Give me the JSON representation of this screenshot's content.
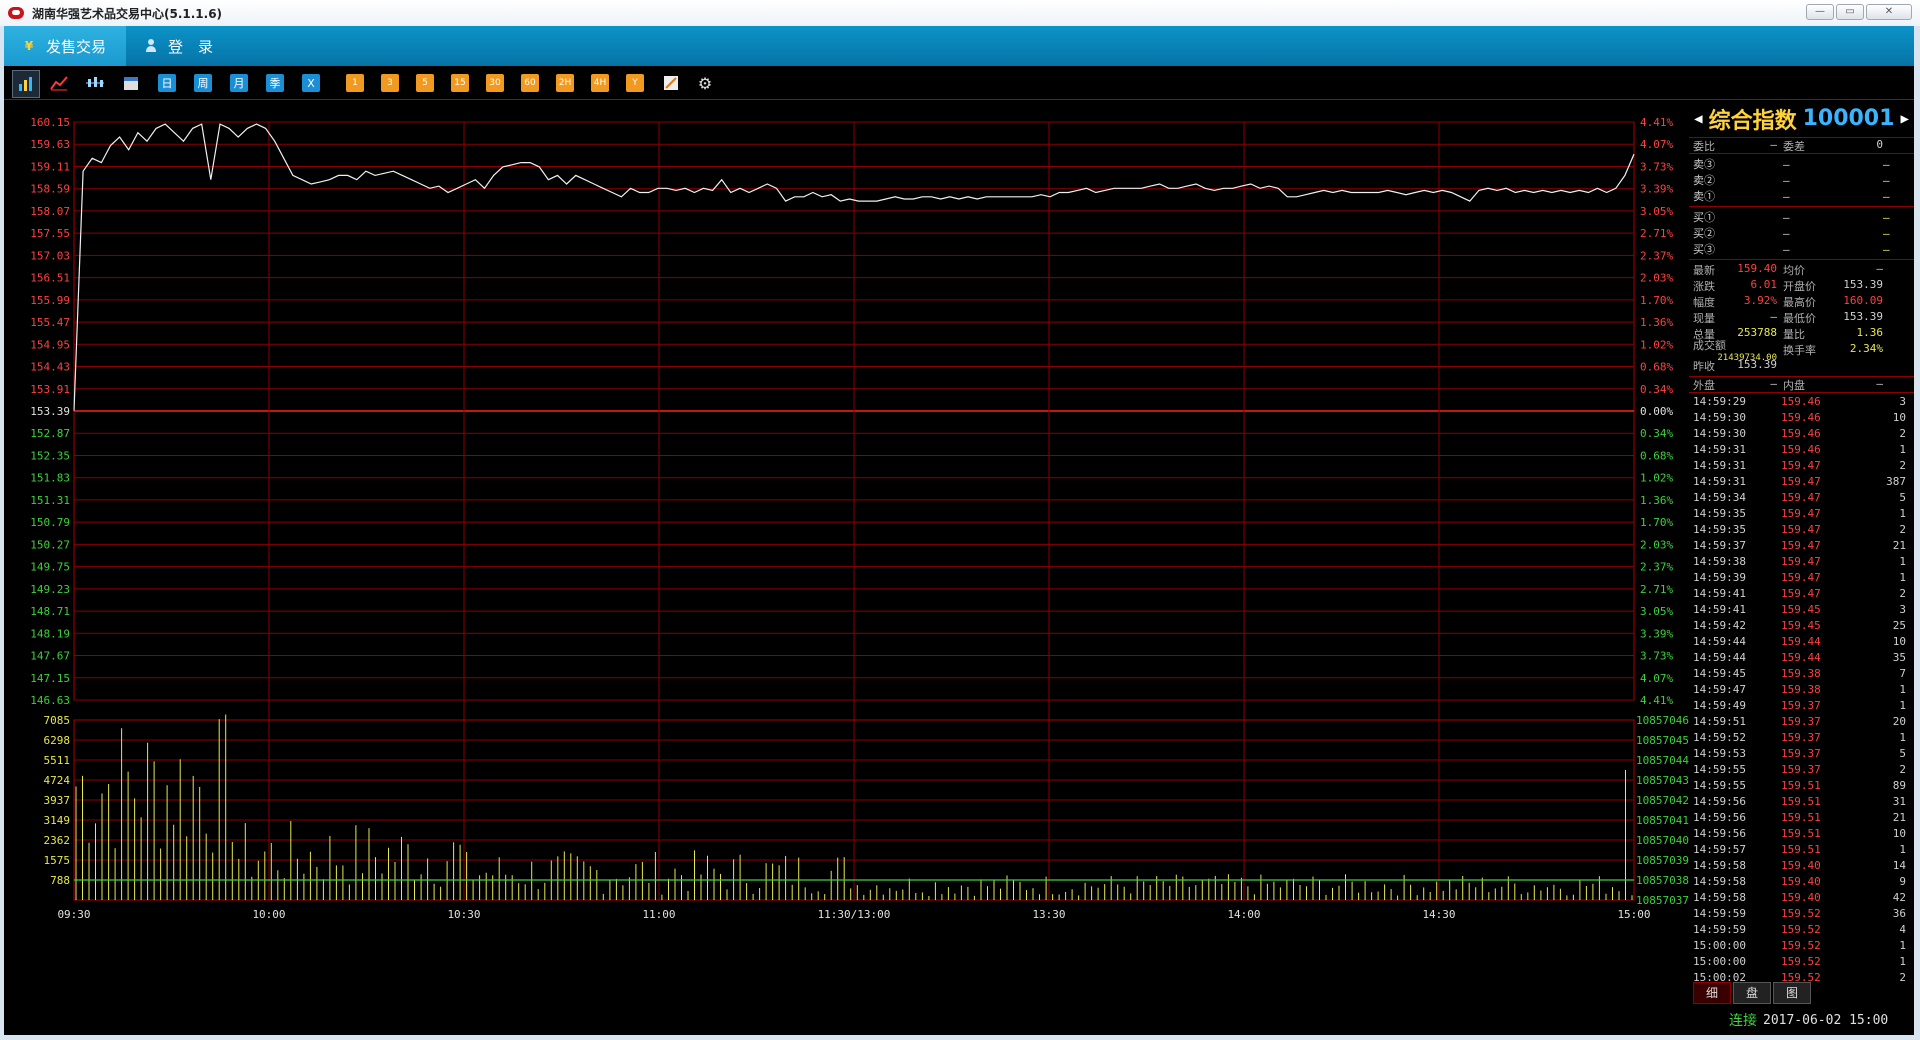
{
  "window": {
    "title": "湖南华强艺术品交易中心(5.1.1.6)"
  },
  "menu": {
    "items": [
      {
        "label": "发售交易"
      },
      {
        "label": "登　录"
      }
    ]
  },
  "toolbar": {
    "periods": [
      "日",
      "周",
      "月",
      "季",
      "X"
    ],
    "minutes": [
      "1",
      "3",
      "5",
      "15",
      "30",
      "60",
      "2H",
      "4H",
      "Y"
    ]
  },
  "quote": {
    "name": "综合指数",
    "code": "100001",
    "weibi_label": "委比",
    "weibi": "—",
    "weicha_label": "委差",
    "weicha": "0",
    "sells": [
      {
        "label": "卖③",
        "price": "—",
        "vol": "—"
      },
      {
        "label": "卖②",
        "price": "—",
        "vol": "—"
      },
      {
        "label": "卖①",
        "price": "—",
        "vol": "—"
      }
    ],
    "buys": [
      {
        "label": "买①",
        "price": "—",
        "vol": "—"
      },
      {
        "label": "买②",
        "price": "—",
        "vol": "—"
      },
      {
        "label": "买③",
        "price": "—",
        "vol": "—"
      }
    ],
    "stats": [
      {
        "l1": "最新",
        "v1": "159.40",
        "l2": "均价",
        "v2": "—"
      },
      {
        "l1": "涨跌",
        "v1": "6.01",
        "l2": "开盘价",
        "v2": "153.39"
      },
      {
        "l1": "幅度",
        "v1": "3.92%",
        "l2": "最高价",
        "v2": "160.09"
      },
      {
        "l1": "现量",
        "v1": "—",
        "l2": "最低价",
        "v2": "153.39"
      },
      {
        "l1": "总量",
        "v1": "253788",
        "l2": "量比",
        "v2": "1.36"
      },
      {
        "l1": "成交额",
        "v1": "21439734.00",
        "l2": "换手率",
        "v2": "2.34%"
      },
      {
        "l1": "昨收",
        "v1": "153.39",
        "l2": "",
        "v2": ""
      }
    ],
    "waipan_label": "外盘",
    "waipan": "—",
    "neipan_label": "内盘",
    "neipan": "—"
  },
  "ticks": [
    [
      "14:59:29",
      "159.46",
      "3"
    ],
    [
      "14:59:30",
      "159.46",
      "10"
    ],
    [
      "14:59:30",
      "159.46",
      "2"
    ],
    [
      "14:59:31",
      "159.46",
      "1"
    ],
    [
      "14:59:31",
      "159.47",
      "2"
    ],
    [
      "14:59:31",
      "159.47",
      "387"
    ],
    [
      "14:59:34",
      "159.47",
      "5"
    ],
    [
      "14:59:35",
      "159.47",
      "1"
    ],
    [
      "14:59:35",
      "159.47",
      "2"
    ],
    [
      "14:59:37",
      "159.47",
      "21"
    ],
    [
      "14:59:38",
      "159.47",
      "1"
    ],
    [
      "14:59:39",
      "159.47",
      "1"
    ],
    [
      "14:59:41",
      "159.47",
      "2"
    ],
    [
      "14:59:41",
      "159.45",
      "3"
    ],
    [
      "14:59:42",
      "159.45",
      "25"
    ],
    [
      "14:59:44",
      "159.44",
      "10"
    ],
    [
      "14:59:44",
      "159.44",
      "35"
    ],
    [
      "14:59:45",
      "159.38",
      "7"
    ],
    [
      "14:59:47",
      "159.38",
      "1"
    ],
    [
      "14:59:49",
      "159.37",
      "1"
    ],
    [
      "14:59:51",
      "159.37",
      "20"
    ],
    [
      "14:59:52",
      "159.37",
      "1"
    ],
    [
      "14:59:53",
      "159.37",
      "5"
    ],
    [
      "14:59:55",
      "159.37",
      "2"
    ],
    [
      "14:59:55",
      "159.51",
      "89"
    ],
    [
      "14:59:56",
      "159.51",
      "31"
    ],
    [
      "14:59:56",
      "159.51",
      "21"
    ],
    [
      "14:59:56",
      "159.51",
      "10"
    ],
    [
      "14:59:57",
      "159.51",
      "1"
    ],
    [
      "14:59:58",
      "159.40",
      "14"
    ],
    [
      "14:59:58",
      "159.40",
      "9"
    ],
    [
      "14:59:58",
      "159.40",
      "42"
    ],
    [
      "14:59:59",
      "159.52",
      "36"
    ],
    [
      "14:59:59",
      "159.52",
      "4"
    ],
    [
      "15:00:00",
      "159.52",
      "1"
    ],
    [
      "15:00:00",
      "159.52",
      "1"
    ],
    [
      "15:00:02",
      "159.52",
      "2"
    ]
  ],
  "tabs": [
    "细",
    "盘",
    "图"
  ],
  "status": {
    "conn": "连接",
    "datetime": "2017-06-02 15:00"
  },
  "chart_data": {
    "type": "line",
    "price_ticks_up": [
      "160.15",
      "159.63",
      "159.11",
      "158.59",
      "158.07",
      "157.55",
      "157.03",
      "156.51",
      "155.99",
      "155.47",
      "154.95",
      "154.43",
      "153.91"
    ],
    "price_mid": "153.39",
    "price_ticks_down": [
      "152.87",
      "152.35",
      "151.83",
      "151.31",
      "150.79",
      "150.27",
      "149.75",
      "149.23",
      "148.71",
      "148.19",
      "147.67",
      "147.15",
      "146.63"
    ],
    "pct_ticks_up": [
      "4.41%",
      "4.07%",
      "3.73%",
      "3.39%",
      "3.05%",
      "2.71%",
      "2.37%",
      "2.03%",
      "1.70%",
      "1.36%",
      "1.02%",
      "0.68%",
      "0.34%"
    ],
    "pct_mid": "0.00%",
    "pct_ticks_down": [
      "0.34%",
      "0.68%",
      "1.02%",
      "1.36%",
      "1.70%",
      "2.03%",
      "2.37%",
      "2.71%",
      "3.05%",
      "3.39%",
      "3.73%",
      "4.07%",
      "4.41%"
    ],
    "vol_ticks": [
      "7085",
      "6298",
      "5511",
      "4724",
      "3937",
      "3149",
      "2362",
      "1575",
      "788"
    ],
    "vol_right_ticks": [
      "10857046",
      "10857045",
      "10857044",
      "10857043",
      "10857042",
      "10857041",
      "10857040",
      "10857039",
      "10857038",
      "10857037"
    ],
    "x_labels": [
      "09:30",
      "10:00",
      "10:30",
      "11:00",
      "11:30/13:00",
      "13:30",
      "14:00",
      "14:30",
      "15:00"
    ],
    "ylim": [
      146.63,
      160.15
    ],
    "vol_ylim": [
      0,
      7085
    ],
    "price": [
      153.4,
      159.0,
      159.3,
      159.2,
      159.6,
      159.8,
      159.5,
      159.9,
      159.7,
      160.0,
      160.1,
      159.9,
      159.7,
      160.0,
      160.1,
      158.8,
      160.1,
      160.0,
      159.8,
      160.0,
      160.1,
      160.0,
      159.7,
      159.3,
      158.9,
      158.8,
      158.7,
      158.75,
      158.8,
      158.9,
      158.9,
      158.8,
      159.0,
      158.9,
      158.95,
      159.0,
      158.9,
      158.8,
      158.7,
      158.6,
      158.65,
      158.5,
      158.6,
      158.7,
      158.8,
      158.6,
      158.9,
      159.1,
      159.15,
      159.2,
      159.2,
      159.1,
      158.8,
      158.9,
      158.7,
      158.9,
      158.8,
      158.7,
      158.6,
      158.5,
      158.4,
      158.6,
      158.5,
      158.5,
      158.6,
      158.6,
      158.55,
      158.6,
      158.5,
      158.6,
      158.55,
      158.8,
      158.5,
      158.6,
      158.5,
      158.6,
      158.7,
      158.6,
      158.3,
      158.4,
      158.4,
      158.5,
      158.4,
      158.45,
      158.3,
      158.35,
      158.3,
      158.3,
      158.3,
      158.35,
      158.4,
      158.35,
      158.35,
      158.4,
      158.4,
      158.35,
      158.4,
      158.35,
      158.4,
      158.35,
      158.4,
      158.4,
      158.4,
      158.4,
      158.4,
      158.4,
      158.45,
      158.4,
      158.5,
      158.5,
      158.55,
      158.6,
      158.5,
      158.55,
      158.6,
      158.6,
      158.6,
      158.6,
      158.65,
      158.7,
      158.6,
      158.6,
      158.65,
      158.7,
      158.6,
      158.55,
      158.6,
      158.6,
      158.65,
      158.7,
      158.6,
      158.65,
      158.6,
      158.4,
      158.4,
      158.45,
      158.5,
      158.55,
      158.5,
      158.55,
      158.5,
      158.5,
      158.5,
      158.5,
      158.55,
      158.5,
      158.45,
      158.5,
      158.55,
      158.5,
      158.55,
      158.5,
      158.4,
      158.3,
      158.55,
      158.6,
      158.55,
      158.6,
      158.5,
      158.55,
      158.5,
      158.55,
      158.5,
      158.55,
      158.5,
      158.55,
      158.5,
      158.6,
      158.5,
      158.6,
      158.9,
      159.4
    ]
  }
}
